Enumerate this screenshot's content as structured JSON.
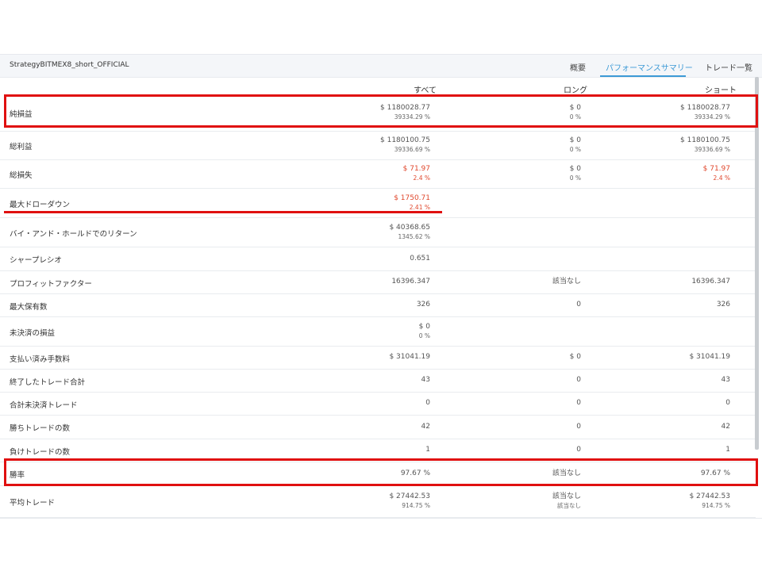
{
  "strategy_name": "StrategyBITMEX8_short_OFFICIAL",
  "tabs": [
    {
      "label": "概要",
      "active": false
    },
    {
      "label": "パフォーマンスサマリー",
      "active": true
    },
    {
      "label": "トレード一覧",
      "active": false
    }
  ],
  "columns": [
    "すべて",
    "ロング",
    "ショート"
  ],
  "rows": [
    {
      "label": "純損益",
      "all": {
        "main": "$ 1180028.77",
        "sub": "39334.29 %"
      },
      "long": {
        "main": "$ 0",
        "sub": "0 %"
      },
      "short": {
        "main": "$ 1180028.77",
        "sub": "39334.29 %"
      }
    },
    {
      "label": "総利益",
      "all": {
        "main": "$ 1180100.75",
        "sub": "39336.69 %"
      },
      "long": {
        "main": "$ 0",
        "sub": "0 %"
      },
      "short": {
        "main": "$ 1180100.75",
        "sub": "39336.69 %"
      }
    },
    {
      "label": "総損失",
      "all": {
        "main": "$ 71.97",
        "sub": "2.4 %",
        "negative": true
      },
      "long": {
        "main": "$ 0",
        "sub": "0 %"
      },
      "short": {
        "main": "$ 71.97",
        "sub": "2.4 %",
        "negative": true
      }
    },
    {
      "label": "最大ドローダウン",
      "all": {
        "main": "$ 1750.71",
        "sub": "2.41 %",
        "negative": true
      },
      "long": {
        "main": "",
        "sub": ""
      },
      "short": {
        "main": "",
        "sub": ""
      }
    },
    {
      "label": "バイ・アンド・ホールドでのリターン",
      "all": {
        "main": "$ 40368.65",
        "sub": "1345.62 %"
      },
      "long": {
        "main": "",
        "sub": ""
      },
      "short": {
        "main": "",
        "sub": ""
      }
    },
    {
      "label": "シャープレシオ",
      "all": {
        "main": "0.651",
        "sub": ""
      },
      "long": {
        "main": "",
        "sub": ""
      },
      "short": {
        "main": "",
        "sub": ""
      }
    },
    {
      "label": "プロフィットファクター",
      "all": {
        "main": "16396.347",
        "sub": ""
      },
      "long": {
        "main": "該当なし",
        "sub": ""
      },
      "short": {
        "main": "16396.347",
        "sub": ""
      }
    },
    {
      "label": "最大保有数",
      "all": {
        "main": "326",
        "sub": ""
      },
      "long": {
        "main": "0",
        "sub": ""
      },
      "short": {
        "main": "326",
        "sub": ""
      }
    },
    {
      "label": "未決済の損益",
      "all": {
        "main": "$ 0",
        "sub": "0 %"
      },
      "long": {
        "main": "",
        "sub": ""
      },
      "short": {
        "main": "",
        "sub": ""
      }
    },
    {
      "label": "支払い済み手数料",
      "all": {
        "main": "$ 31041.19",
        "sub": ""
      },
      "long": {
        "main": "$ 0",
        "sub": ""
      },
      "short": {
        "main": "$ 31041.19",
        "sub": ""
      }
    },
    {
      "label": "終了したトレード合計",
      "all": {
        "main": "43",
        "sub": ""
      },
      "long": {
        "main": "0",
        "sub": ""
      },
      "short": {
        "main": "43",
        "sub": ""
      }
    },
    {
      "label": "合計未決済トレード",
      "all": {
        "main": "0",
        "sub": ""
      },
      "long": {
        "main": "0",
        "sub": ""
      },
      "short": {
        "main": "0",
        "sub": ""
      }
    },
    {
      "label": "勝ちトレードの数",
      "all": {
        "main": "42",
        "sub": ""
      },
      "long": {
        "main": "0",
        "sub": ""
      },
      "short": {
        "main": "42",
        "sub": ""
      }
    },
    {
      "label": "負けトレードの数",
      "all": {
        "main": "1",
        "sub": ""
      },
      "long": {
        "main": "0",
        "sub": ""
      },
      "short": {
        "main": "1",
        "sub": ""
      }
    },
    {
      "label": "勝率",
      "all": {
        "main": "97.67 %",
        "sub": ""
      },
      "long": {
        "main": "該当なし",
        "sub": ""
      },
      "short": {
        "main": "97.67 %",
        "sub": ""
      }
    },
    {
      "label": "平均トレード",
      "all": {
        "main": "$ 27442.53",
        "sub": "914.75 %"
      },
      "long": {
        "main": "該当なし",
        "sub": "該当なし"
      },
      "short": {
        "main": "$ 27442.53",
        "sub": "914.75 %"
      }
    }
  ],
  "colors": {
    "accent": "#3d9ad6",
    "negative": "#e0472c",
    "highlight": "#e01010"
  }
}
